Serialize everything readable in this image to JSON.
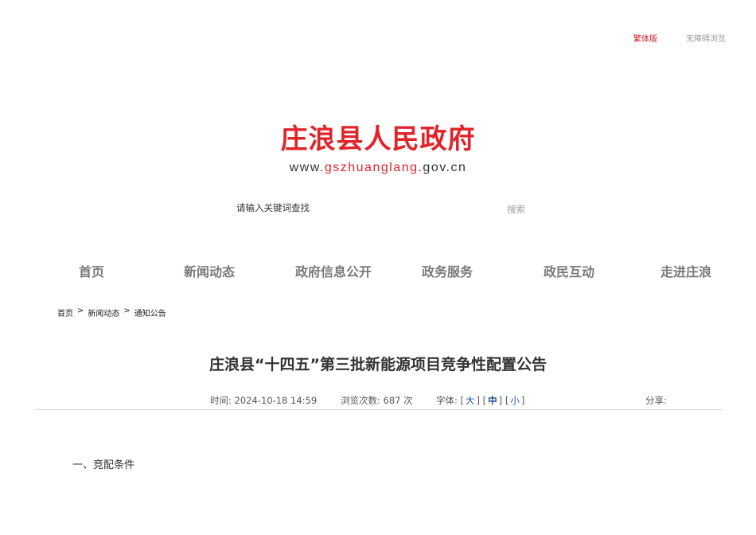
{
  "top_links": {
    "traditional": "繁体版",
    "accessible": "无障碍浏览"
  },
  "logo": {
    "title": "庄浪县人民政府",
    "url_prefix": "www.",
    "url_domain": "gszhuanglang",
    "url_suffix": ".gov.cn"
  },
  "search": {
    "placeholder": "请输入关键词查找",
    "button_label": "搜索"
  },
  "nav": {
    "items": [
      "首页",
      "新闻动态",
      "政府信息公开",
      "政务服务",
      "政民互动",
      "走进庄浪"
    ]
  },
  "breadcrumb": {
    "items": [
      "首页",
      "新闻动态",
      "通知公告"
    ],
    "separator": ">"
  },
  "article": {
    "title": "庄浪县“十四五”第三批新能源项目竞争性配置公告",
    "time_label": "时间:",
    "time_value": "2024-10-18 14:59",
    "views_label": "浏览次数:",
    "views_value": "687 次",
    "font_label": "字体:",
    "font_sizes": [
      "大",
      "中",
      "小"
    ],
    "share_label": "分享:",
    "section_1": "一、竞配条件"
  },
  "colors": {
    "brand_red": "#e0242b",
    "traditional_link": "#c8161d",
    "nav_text": "#7a7a7a",
    "font_size_link": "#1a5aa5"
  }
}
